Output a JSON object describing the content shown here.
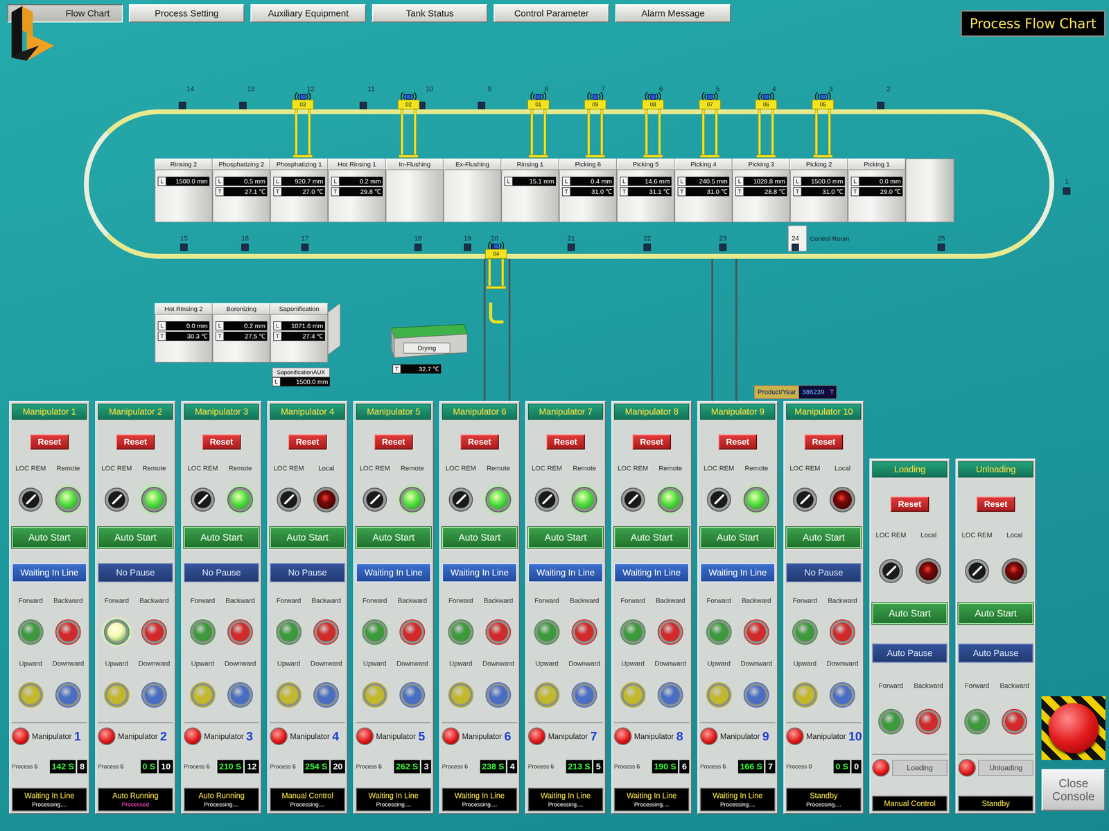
{
  "title": "Process Flow Chart",
  "tabs": [
    {
      "label": "Flow Chart",
      "selected": true
    },
    {
      "label": "Process Setting",
      "selected": false
    },
    {
      "label": "Auxiliary Equipment",
      "selected": false
    },
    {
      "label": "Tank Status",
      "selected": false
    },
    {
      "label": "Control Parameter",
      "selected": false
    },
    {
      "label": "Alarm Message",
      "selected": false
    }
  ],
  "track": {
    "top_positions": [
      "14",
      "13",
      "12",
      "11",
      "10",
      "9",
      "8",
      "7",
      "6",
      "5",
      "4",
      "3",
      "2"
    ],
    "right_positions": [
      "1"
    ],
    "bottom_positions": [
      "15",
      "16",
      "17",
      "18",
      "19",
      "20",
      "21",
      "22",
      "23",
      "24",
      "25"
    ],
    "control_room": "Control Room"
  },
  "carriers": {
    "top": [
      "03",
      "02",
      "01",
      "09",
      "08",
      "07",
      "06",
      "05"
    ],
    "bottom": [
      "04"
    ]
  },
  "tanks": [
    {
      "name": "Rinsing 2",
      "readings": [
        {
          "label": "L",
          "value": "1500.0 mm"
        }
      ]
    },
    {
      "name": "Phosphatizing 2",
      "readings": [
        {
          "label": "L",
          "value": "0.5 mm"
        },
        {
          "label": "T",
          "value": "27.1 ℃"
        }
      ]
    },
    {
      "name": "Phosphatizing 1",
      "readings": [
        {
          "label": "L",
          "value": "920.7 mm"
        },
        {
          "label": "T",
          "value": "27.0 ℃"
        }
      ]
    },
    {
      "name": "Hot Rinsing 1",
      "readings": [
        {
          "label": "L",
          "value": "0.2 mm"
        },
        {
          "label": "T",
          "value": "29.8 ℃"
        }
      ]
    },
    {
      "name": "In-Flushing",
      "readings": []
    },
    {
      "name": "Ex-Flushing",
      "readings": []
    },
    {
      "name": "Rinsing 1",
      "readings": [
        {
          "label": "L",
          "value": "15.1 mm"
        }
      ]
    },
    {
      "name": "Picking 6",
      "readings": [
        {
          "label": "L",
          "value": "0.4 mm"
        },
        {
          "label": "T",
          "value": "31.0 ℃"
        }
      ]
    },
    {
      "name": "Picking 5",
      "readings": [
        {
          "label": "L",
          "value": "14.6 mm"
        },
        {
          "label": "T",
          "value": "31.1 ℃"
        }
      ]
    },
    {
      "name": "Picking 4",
      "readings": [
        {
          "label": "L",
          "value": "240.5 mm"
        },
        {
          "label": "T",
          "value": "31.0 ℃"
        }
      ]
    },
    {
      "name": "Picking 3",
      "readings": [
        {
          "label": "L",
          "value": "1028.8 mm"
        },
        {
          "label": "T",
          "value": "28.8 ℃"
        }
      ]
    },
    {
      "name": "Picking 2",
      "readings": [
        {
          "label": "L",
          "value": "1500.0 mm"
        },
        {
          "label": "T",
          "value": "31.0 ℃"
        }
      ]
    },
    {
      "name": "Picking 1",
      "readings": [
        {
          "label": "L",
          "value": "0.0 mm"
        },
        {
          "label": "T",
          "value": "29.0 ℃"
        }
      ]
    }
  ],
  "lower_tanks": [
    {
      "name": "Hot Rinsing 2",
      "readings": [
        {
          "label": "L",
          "value": "0.0 mm"
        },
        {
          "label": "T",
          "value": "30.3 ℃"
        }
      ]
    },
    {
      "name": "Boronizing",
      "readings": [
        {
          "label": "L",
          "value": "0.2 mm"
        },
        {
          "label": "T",
          "value": "27.5 ℃"
        }
      ]
    },
    {
      "name": "Saponification",
      "readings": [
        {
          "label": "L",
          "value": "1071.6 mm"
        },
        {
          "label": "T",
          "value": "27.4 ℃"
        }
      ]
    }
  ],
  "saponification_aux": {
    "name": "SaponificationAUX",
    "readings": [
      {
        "label": "L",
        "value": "1500.0 mm"
      }
    ]
  },
  "drying": {
    "name": "Drying",
    "readings": [
      {
        "label": "T",
        "value": "32.7 ℃"
      }
    ]
  },
  "product": {
    "label": "Product/Year",
    "value": "386239",
    "unit": "T"
  },
  "panels": [
    {
      "kind": "manipulator",
      "title": "Manipulator 1",
      "reset": "Reset",
      "switch_label": "LOC  REM",
      "mode": "Remote",
      "remote": true,
      "start": "Auto Start",
      "hold": {
        "label": "Waiting In Line",
        "kind": "waiting"
      },
      "motions": [
        {
          "label": "Forward",
          "color": "#3c9a3c",
          "lit": false
        },
        {
          "label": "Backward",
          "color": "#d22a2a",
          "lit": false
        },
        {
          "label": "Upward",
          "color": "#c2b82c",
          "lit": false
        },
        {
          "label": "Downward",
          "color": "#4a6ec4",
          "lit": false
        }
      ],
      "name": "Manipulator",
      "number": "1",
      "process_label": "Process",
      "process": "6",
      "time": "142 S",
      "step": "8",
      "status": "Waiting In Line",
      "substatus": {
        "text": "Processing....",
        "kind": "processing"
      }
    },
    {
      "kind": "manipulator",
      "title": "Manipulator 2",
      "reset": "Reset",
      "switch_label": "LOC  REM",
      "mode": "Remote",
      "remote": true,
      "start": "Auto Start",
      "hold": {
        "label": "No Pause",
        "kind": "pause"
      },
      "motions": [
        {
          "label": "Forward",
          "color": "#3c9a3c",
          "lit": true
        },
        {
          "label": "Backward",
          "color": "#d22a2a",
          "lit": false
        },
        {
          "label": "Upward",
          "color": "#c2b82c",
          "lit": false
        },
        {
          "label": "Downward",
          "color": "#4a6ec4",
          "lit": false
        }
      ],
      "name": "Manipulator",
      "number": "2",
      "process_label": "Process",
      "process": "6",
      "time": "0 S",
      "step": "10",
      "status": "Auto Running",
      "substatus": {
        "text": "Processed",
        "kind": "processed"
      }
    },
    {
      "kind": "manipulator",
      "title": "Manipulator 3",
      "reset": "Reset",
      "switch_label": "LOC  REM",
      "mode": "Remote",
      "remote": true,
      "start": "Auto Start",
      "hold": {
        "label": "No Pause",
        "kind": "pause"
      },
      "motions": [
        {
          "label": "Forward",
          "color": "#3c9a3c",
          "lit": false
        },
        {
          "label": "Backward",
          "color": "#d22a2a",
          "lit": false
        },
        {
          "label": "Upward",
          "color": "#c2b82c",
          "lit": false
        },
        {
          "label": "Downward",
          "color": "#4a6ec4",
          "lit": false
        }
      ],
      "name": "Manipulator",
      "number": "3",
      "process_label": "Process",
      "process": "6",
      "time": "210 S",
      "step": "12",
      "status": "Auto Running",
      "substatus": {
        "text": "Processing....",
        "kind": "processing"
      }
    },
    {
      "kind": "manipulator",
      "title": "Manipulator 4",
      "reset": "Reset",
      "switch_label": "LOC  REM",
      "mode": "Local",
      "remote": false,
      "start": "Auto Start",
      "hold": {
        "label": "No Pause",
        "kind": "pause"
      },
      "motions": [
        {
          "label": "Forward",
          "color": "#3c9a3c",
          "lit": false
        },
        {
          "label": "Backward",
          "color": "#d22a2a",
          "lit": false
        },
        {
          "label": "Upward",
          "color": "#c2b82c",
          "lit": false
        },
        {
          "label": "Downward",
          "color": "#4a6ec4",
          "lit": false
        }
      ],
      "name": "Manipulator",
      "number": "4",
      "process_label": "Process",
      "process": "6",
      "time": "254 S",
      "step": "20",
      "status": "Manual Control",
      "substatus": {
        "text": "Processing....",
        "kind": "processing"
      }
    },
    {
      "kind": "manipulator",
      "title": "Manipulator 5",
      "reset": "Reset",
      "switch_label": "LOC  REM",
      "mode": "Remote",
      "remote": true,
      "start": "Auto Start",
      "hold": {
        "label": "Waiting In Line",
        "kind": "waiting"
      },
      "motions": [
        {
          "label": "Forward",
          "color": "#3c9a3c",
          "lit": false
        },
        {
          "label": "Backward",
          "color": "#d22a2a",
          "lit": false
        },
        {
          "label": "Upward",
          "color": "#c2b82c",
          "lit": false
        },
        {
          "label": "Downward",
          "color": "#4a6ec4",
          "lit": false
        }
      ],
      "name": "Manipulator",
      "number": "5",
      "process_label": "Process",
      "process": "6",
      "time": "262 S",
      "step": "3",
      "status": "Waiting In Line",
      "substatus": {
        "text": "Processing....",
        "kind": "processing"
      }
    },
    {
      "kind": "manipulator",
      "title": "Manipulator 6",
      "reset": "Reset",
      "switch_label": "LOC  REM",
      "mode": "Remote",
      "remote": true,
      "start": "Auto Start",
      "hold": {
        "label": "Waiting In Line",
        "kind": "waiting"
      },
      "motions": [
        {
          "label": "Forward",
          "color": "#3c9a3c",
          "lit": false
        },
        {
          "label": "Backward",
          "color": "#d22a2a",
          "lit": false
        },
        {
          "label": "Upward",
          "color": "#c2b82c",
          "lit": false
        },
        {
          "label": "Downward",
          "color": "#4a6ec4",
          "lit": false
        }
      ],
      "name": "Manipulator",
      "number": "6",
      "process_label": "Process",
      "process": "6",
      "time": "238 S",
      "step": "4",
      "status": "Waiting In Line",
      "substatus": {
        "text": "Processing....",
        "kind": "processing"
      }
    },
    {
      "kind": "manipulator",
      "title": "Manipulator 7",
      "reset": "Reset",
      "switch_label": "LOC  REM",
      "mode": "Remote",
      "remote": true,
      "start": "Auto Start",
      "hold": {
        "label": "Waiting In Line",
        "kind": "waiting"
      },
      "motions": [
        {
          "label": "Forward",
          "color": "#3c9a3c",
          "lit": false
        },
        {
          "label": "Backward",
          "color": "#d22a2a",
          "lit": false
        },
        {
          "label": "Upward",
          "color": "#c2b82c",
          "lit": false
        },
        {
          "label": "Downward",
          "color": "#4a6ec4",
          "lit": false
        }
      ],
      "name": "Manipulator",
      "number": "7",
      "process_label": "Process",
      "process": "6",
      "time": "213 S",
      "step": "5",
      "status": "Waiting In Line",
      "substatus": {
        "text": "Processing....",
        "kind": "processing"
      }
    },
    {
      "kind": "manipulator",
      "title": "Manipulator 8",
      "reset": "Reset",
      "switch_label": "LOC  REM",
      "mode": "Remote",
      "remote": true,
      "start": "Auto Start",
      "hold": {
        "label": "Waiting In Line",
        "kind": "waiting"
      },
      "motions": [
        {
          "label": "Forward",
          "color": "#3c9a3c",
          "lit": false
        },
        {
          "label": "Backward",
          "color": "#d22a2a",
          "lit": false
        },
        {
          "label": "Upward",
          "color": "#c2b82c",
          "lit": false
        },
        {
          "label": "Downward",
          "color": "#4a6ec4",
          "lit": false
        }
      ],
      "name": "Manipulator",
      "number": "8",
      "process_label": "Process",
      "process": "6",
      "time": "190 S",
      "step": "6",
      "status": "Waiting In Line",
      "substatus": {
        "text": "Processing....",
        "kind": "processing"
      }
    },
    {
      "kind": "manipulator",
      "title": "Manipulator 9",
      "reset": "Reset",
      "switch_label": "LOC  REM",
      "mode": "Remote",
      "remote": true,
      "start": "Auto Start",
      "hold": {
        "label": "Waiting In Line",
        "kind": "waiting"
      },
      "motions": [
        {
          "label": "Forward",
          "color": "#3c9a3c",
          "lit": false
        },
        {
          "label": "Backward",
          "color": "#d22a2a",
          "lit": false
        },
        {
          "label": "Upward",
          "color": "#c2b82c",
          "lit": false
        },
        {
          "label": "Downward",
          "color": "#4a6ec4",
          "lit": false
        }
      ],
      "name": "Manipulator",
      "number": "9",
      "process_label": "Process",
      "process": "6",
      "time": "166 S",
      "step": "7",
      "status": "Waiting In Line",
      "substatus": {
        "text": "Processing....",
        "kind": "processing"
      }
    },
    {
      "kind": "manipulator",
      "title": "Manipulator 10",
      "reset": "Reset",
      "switch_label": "LOC  REM",
      "mode": "Local",
      "remote": false,
      "start": "Auto Start",
      "hold": {
        "label": "No Pause",
        "kind": "pause"
      },
      "motions": [
        {
          "label": "Forward",
          "color": "#3c9a3c",
          "lit": false
        },
        {
          "label": "Backward",
          "color": "#d22a2a",
          "lit": false
        },
        {
          "label": "Upward",
          "color": "#c2b82c",
          "lit": false
        },
        {
          "label": "Downward",
          "color": "#4a6ec4",
          "lit": false
        }
      ],
      "name": "Manipulator",
      "number": "10",
      "process_label": "Process",
      "process": "0",
      "time": "0 S",
      "step": "0",
      "status": "Standby",
      "substatus": {
        "text": "Processing....",
        "kind": "processing"
      }
    },
    {
      "kind": "station",
      "title": "Loading",
      "reset": "Reset",
      "switch_label": "LOC  REM",
      "mode": "Local",
      "remote": false,
      "start": "Auto Start",
      "hold": {
        "label": "Auto Pause",
        "kind": "pause"
      },
      "motions": [
        {
          "label": "Forward",
          "color": "#3c9a3c",
          "lit": false
        },
        {
          "label": "Backward",
          "color": "#d22a2a",
          "lit": false
        }
      ],
      "footer_label": "Loading",
      "status": "Manual Control"
    },
    {
      "kind": "station",
      "title": "Unloading",
      "reset": "Reset",
      "switch_label": "LOC  REM",
      "mode": "Local",
      "remote": false,
      "start": "Auto Start",
      "hold": {
        "label": "Auto Pause",
        "kind": "pause"
      },
      "motions": [
        {
          "label": "Forward",
          "color": "#3c9a3c",
          "lit": false
        },
        {
          "label": "Backward",
          "color": "#d22a2a",
          "lit": false
        }
      ],
      "footer_label": "Unloading",
      "status": "Standby"
    }
  ],
  "close_button": "Close Console"
}
